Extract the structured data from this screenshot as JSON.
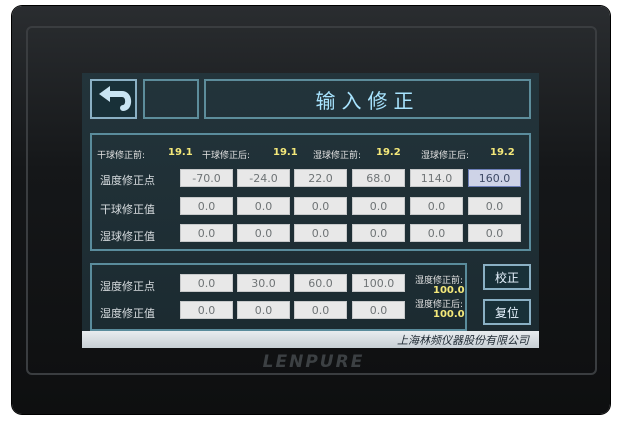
{
  "header": {
    "title": "输入修正"
  },
  "status_line": [
    {
      "label": "干球修正前:",
      "value": "19.1"
    },
    {
      "label": "干球修正后:",
      "value": "19.1"
    },
    {
      "label": "湿球修正前:",
      "value": "19.2"
    },
    {
      "label": "湿球修正后:",
      "value": "19.2"
    }
  ],
  "temp_table": {
    "rows": [
      {
        "label": "温度修正点",
        "values": [
          "-70.0",
          "-24.0",
          "22.0",
          "68.0",
          "114.0",
          "160.0"
        ]
      },
      {
        "label": "干球修正值",
        "values": [
          "0.0",
          "0.0",
          "0.0",
          "0.0",
          "0.0",
          "0.0"
        ]
      },
      {
        "label": "湿球修正值",
        "values": [
          "0.0",
          "0.0",
          "0.0",
          "0.0",
          "0.0",
          "0.0"
        ]
      }
    ]
  },
  "humidity_table": {
    "rows": [
      {
        "label": "湿度修正点",
        "values": [
          "0.0",
          "30.0",
          "60.0",
          "100.0"
        ]
      },
      {
        "label": "湿度修正值",
        "values": [
          "0.0",
          "0.0",
          "0.0",
          "0.0"
        ]
      }
    ],
    "before_label": "湿度修正前:",
    "before_value": "100.0",
    "after_label": "湿度修正后:",
    "after_value": "100.0"
  },
  "buttons": {
    "calibrate": "校正",
    "reset": "复位"
  },
  "footer": {
    "company": "上海林频仪器股份有限公司"
  },
  "device": {
    "brand": "LENPURE"
  },
  "icons": {
    "back": "back-arrow-icon"
  }
}
